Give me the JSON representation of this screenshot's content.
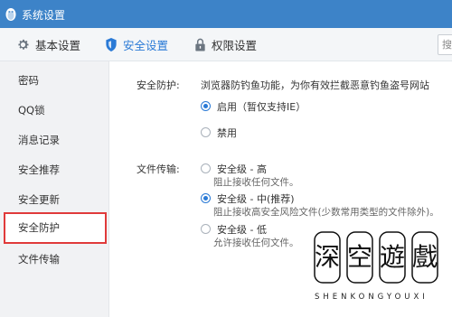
{
  "window": {
    "title": "系统设置"
  },
  "toolbar": {
    "tabs": [
      {
        "label": "基本设置",
        "icon": "gear-icon"
      },
      {
        "label": "安全设置",
        "icon": "shield-icon",
        "active": true
      },
      {
        "label": "权限设置",
        "icon": "lock-icon"
      }
    ],
    "search_text": "搜"
  },
  "sidebar": {
    "items": [
      {
        "label": "密码"
      },
      {
        "label": "QQ锁"
      },
      {
        "label": "消息记录"
      },
      {
        "label": "安全推荐"
      },
      {
        "label": "安全更新"
      },
      {
        "label": "安全防护",
        "selected": true
      },
      {
        "label": "文件传输"
      }
    ]
  },
  "protection": {
    "label": "安全防护:",
    "description": "浏览器防钓鱼功能，为你有效拦截恶意钓鱼盗号网站",
    "options": [
      {
        "label": "启用（暂仅支持IE）",
        "checked": true
      },
      {
        "label": "禁用",
        "checked": false
      }
    ]
  },
  "file_transfer": {
    "label": "文件传输:",
    "options": [
      {
        "label": "安全级 - 高",
        "sub": "阻止接收任何文件。",
        "checked": false
      },
      {
        "label": "安全级 - 中(推荐)",
        "sub": "阻止接收高安全风险文件(少数常用类型的文件除外)。",
        "checked": true
      },
      {
        "label": "安全级 - 低",
        "sub": "允许接收任何文件。",
        "checked": false
      }
    ]
  },
  "watermark": {
    "chars": [
      "深",
      "空",
      "遊",
      "戲"
    ],
    "pinyin": "SHENKONGYOUXI"
  },
  "colors": {
    "titlebar": "#3d83c8",
    "accent": "#2a7ad6",
    "highlight_border": "#e03a3a"
  }
}
